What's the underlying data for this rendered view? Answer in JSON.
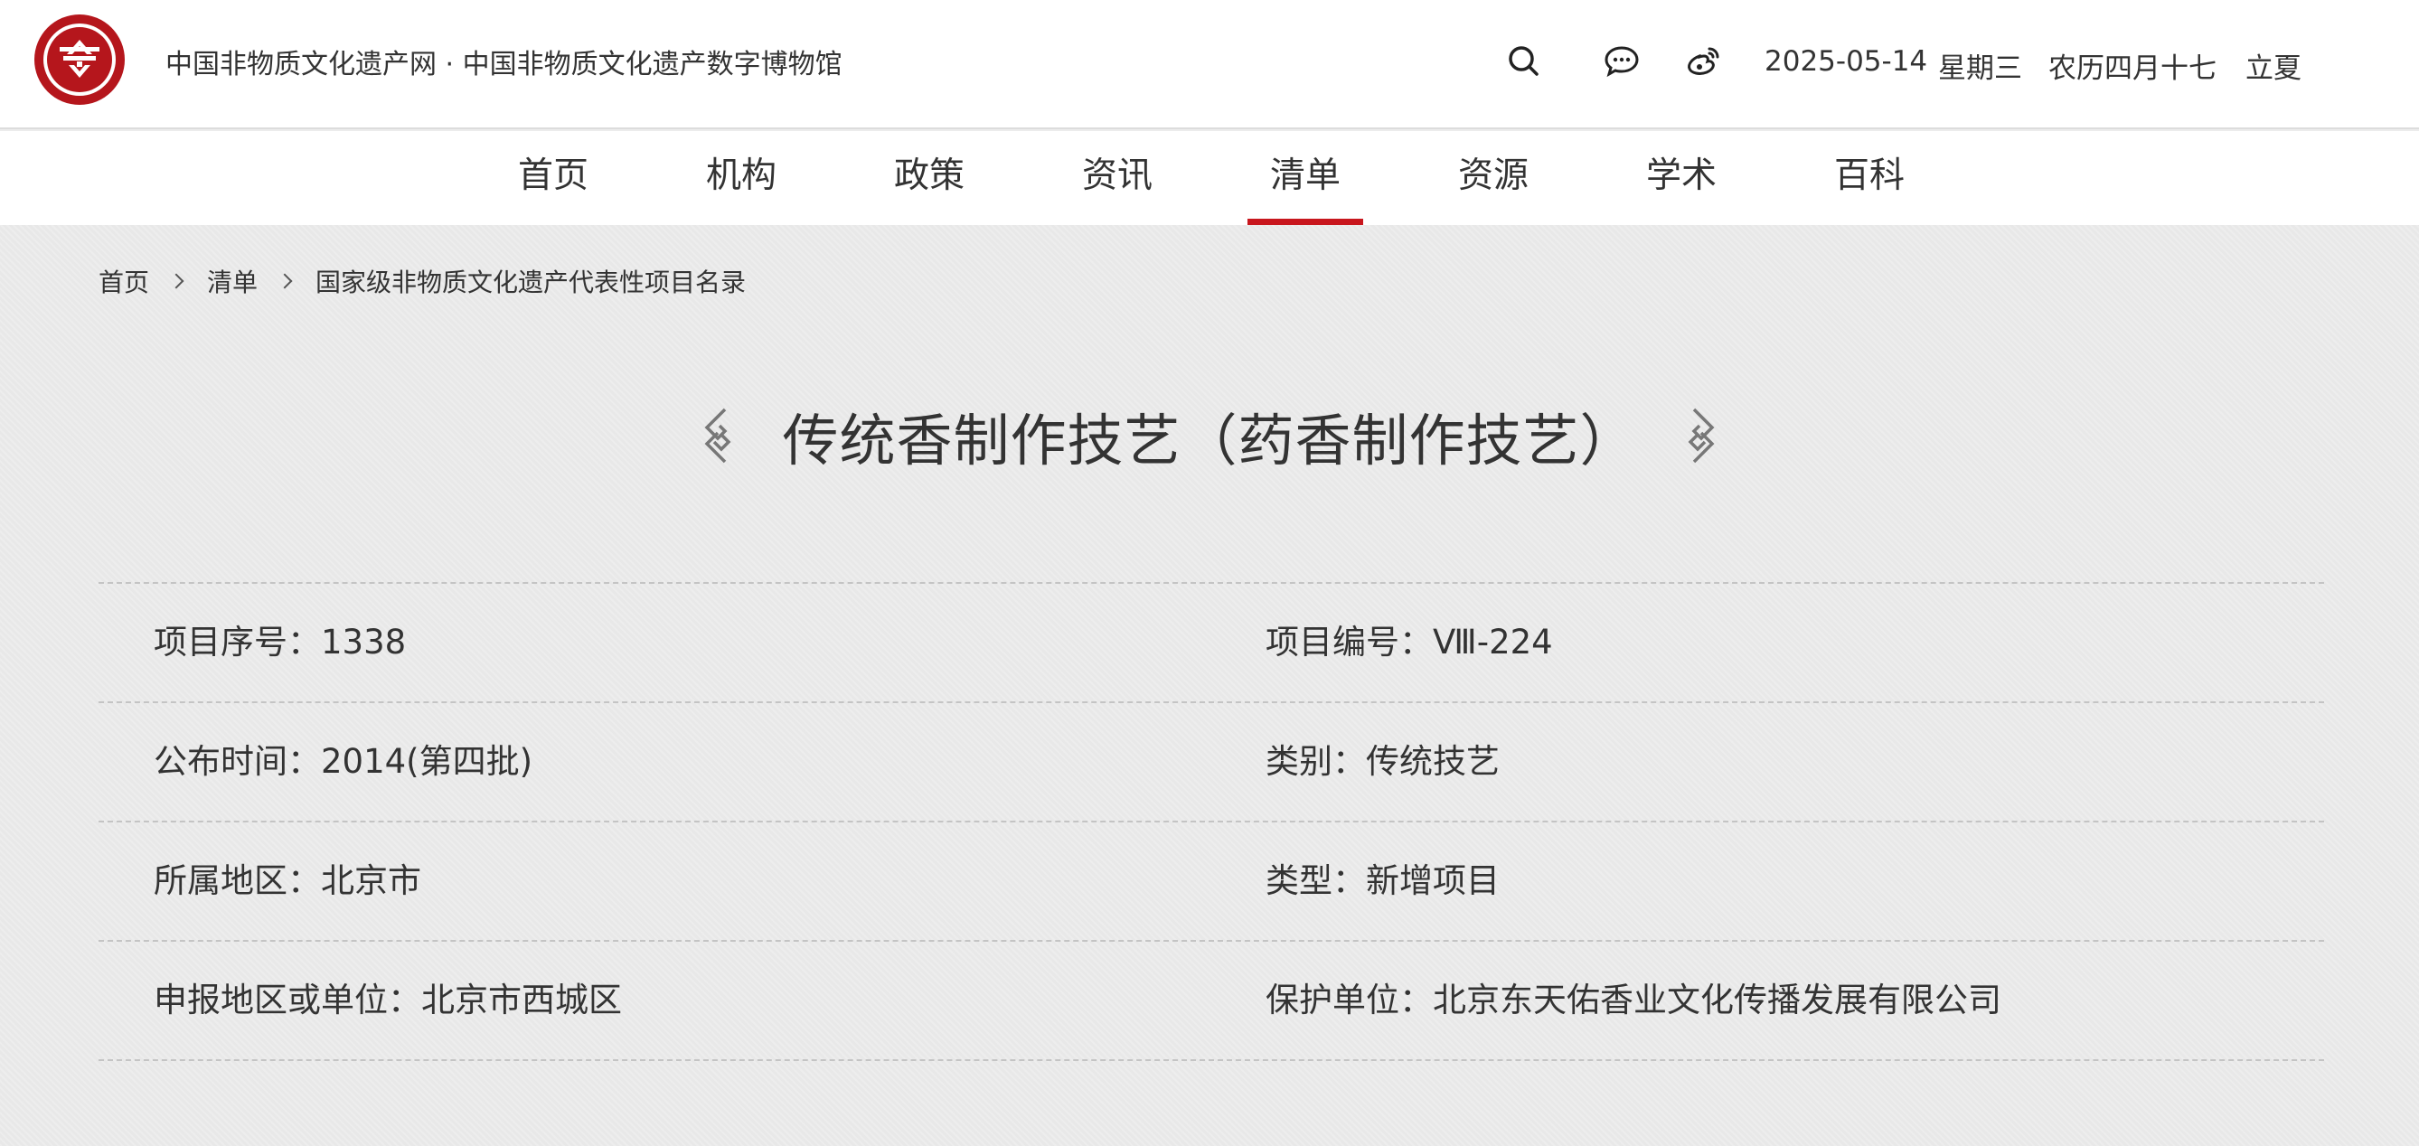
{
  "header": {
    "site_name": "中国非物质文化遗产网 · 中国非物质文化遗产数字博物馆",
    "icons": [
      "search-icon",
      "wechat-icon",
      "weibo-icon"
    ],
    "date": "2025-05-14",
    "weekday": "星期三",
    "lunar_date": "农历四月十七",
    "solar_term": "立夏"
  },
  "nav": {
    "items": [
      {
        "label": "首页"
      },
      {
        "label": "机构"
      },
      {
        "label": "政策"
      },
      {
        "label": "资讯"
      },
      {
        "label": "清单",
        "active": true
      },
      {
        "label": "资源"
      },
      {
        "label": "学术"
      },
      {
        "label": "百科"
      }
    ],
    "active_color": "#c8161d"
  },
  "breadcrumb": [
    "首页",
    "清单",
    "国家级非物质文化遗产代表性项目名录"
  ],
  "project": {
    "title": "传统香制作技艺（药香制作技艺）",
    "fields": [
      {
        "left": "项目序号：1338",
        "right": "项目编号：Ⅷ-224"
      },
      {
        "left": "公布时间：2014(第四批)",
        "right": "类别：传统技艺"
      },
      {
        "left": "所属地区：北京市",
        "right": "类型：新增项目"
      },
      {
        "left": "申报地区或单位：北京市西城区",
        "right": "保护单位：北京东天佑香业文化传播发展有限公司"
      }
    ]
  },
  "colors": {
    "brand_red": "#c8161d",
    "page_bg": "#ececec"
  }
}
